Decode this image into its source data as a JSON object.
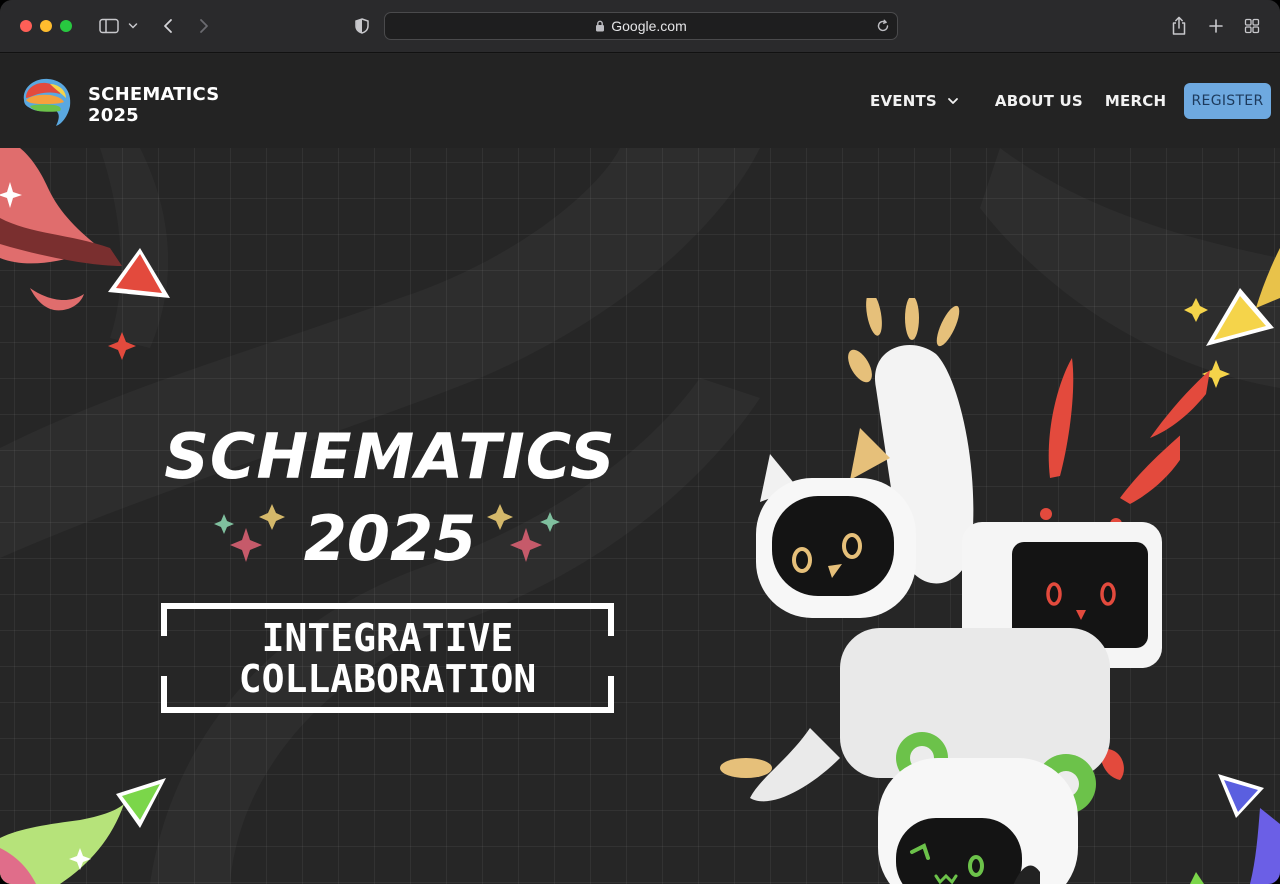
{
  "browser": {
    "url": "Google.com"
  },
  "site": {
    "brand_line1": "SCHEMATICS",
    "brand_line2": "2025",
    "nav": {
      "events": "EVENTS",
      "about": "ABOUT US",
      "merch": "MERCH",
      "register": "REGISTER"
    }
  },
  "hero": {
    "title": "SCHEMATICS",
    "year": "2025",
    "theme_line1": "INTEGRATIVE",
    "theme_line2": "COLLABORATION"
  },
  "colors": {
    "register_bg": "#6ea9e0",
    "accent_red": "#e34a3d",
    "accent_yellow": "#f5d44a",
    "accent_green": "#6cc24a",
    "accent_blue": "#5a5fe0"
  },
  "icons": [
    "sidebar-icon",
    "chevron-down-icon",
    "back-arrow-icon",
    "forward-arrow-icon",
    "shield-icon",
    "lock-icon",
    "reload-icon",
    "share-icon",
    "new-tab-icon",
    "tab-overview-icon"
  ]
}
